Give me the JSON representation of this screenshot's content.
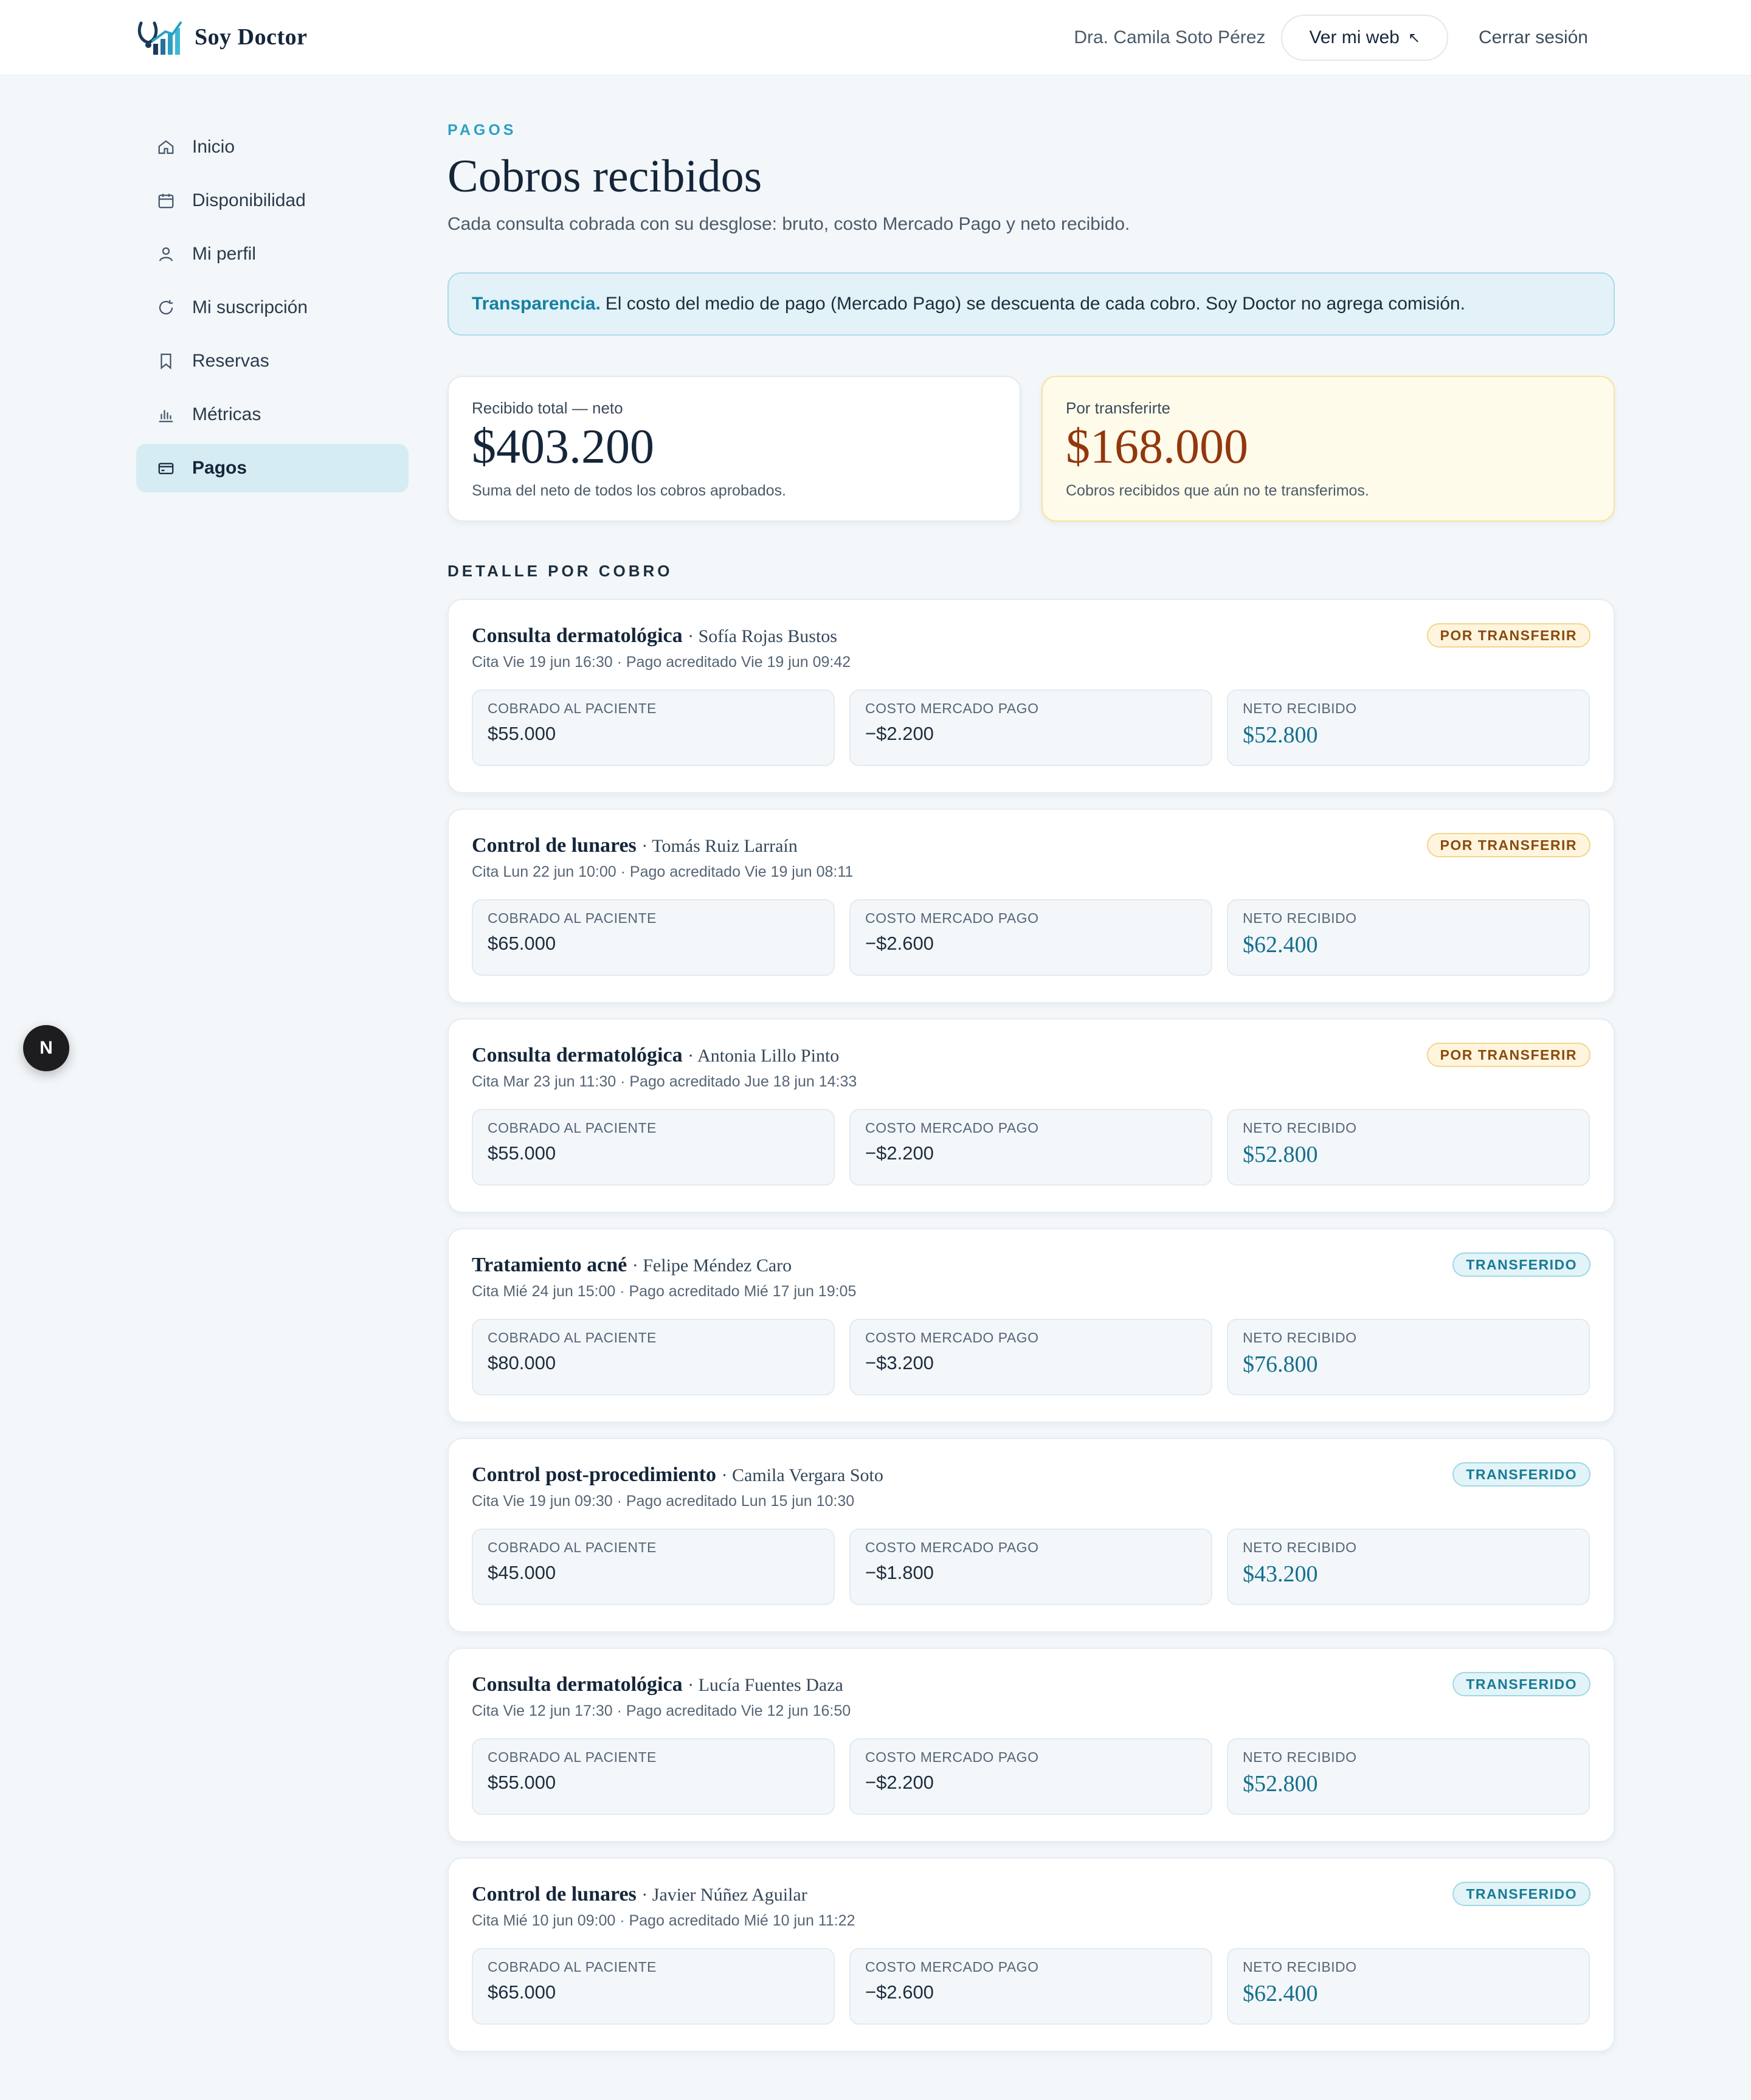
{
  "header": {
    "brand": "Soy Doctor",
    "doctor": "Dra. Camila Soto Pérez",
    "web_button": "Ver mi web",
    "logout": "Cerrar sesión"
  },
  "sidebar": {
    "items": [
      {
        "label": "Inicio",
        "icon": "home-icon"
      },
      {
        "label": "Disponibilidad",
        "icon": "calendar-icon"
      },
      {
        "label": "Mi perfil",
        "icon": "user-icon"
      },
      {
        "label": "Mi suscripción",
        "icon": "refresh-icon"
      },
      {
        "label": "Reservas",
        "icon": "bookmark-icon"
      },
      {
        "label": "Métricas",
        "icon": "bar-chart-icon"
      },
      {
        "label": "Pagos",
        "icon": "credit-card-icon",
        "active": true
      }
    ]
  },
  "fab": "N",
  "page": {
    "eyebrow": "PAGOS",
    "title": "Cobros recibidos",
    "subtitle": "Cada consulta cobrada con su desglose: bruto, costo Mercado Pago y neto recibido."
  },
  "notice": {
    "strong": "Transparencia.",
    "text": "El costo del medio de pago (Mercado Pago) se descuenta de cada cobro. Soy Doctor no agrega comisión."
  },
  "summary": {
    "total": {
      "label": "Recibido total — neto",
      "value": "$403.200",
      "note": "Suma del neto de todos los cobros aprobados."
    },
    "pending": {
      "label": "Por transferirte",
      "value": "$168.000",
      "note": "Cobros recibidos que aún no te transferimos."
    }
  },
  "section_title": "DETALLE POR COBRO",
  "labels": {
    "gross": "COBRADO AL PACIENTE",
    "fee": "COSTO MERCADO PAGO",
    "net": "NETO RECIBIDO"
  },
  "charges": [
    {
      "service": "Consulta dermatológica",
      "patient": "Sofía Rojas Bustos",
      "meta": "Cita Vie 19 jun 16:30 · Pago acreditado Vie 19 jun 09:42",
      "status": "POR TRANSFERIR",
      "status_type": "pending",
      "gross": "$55.000",
      "fee": "−$2.200",
      "net": "$52.800"
    },
    {
      "service": "Control de lunares",
      "patient": "Tomás Ruiz Larraín",
      "meta": "Cita Lun 22 jun 10:00 · Pago acreditado Vie 19 jun 08:11",
      "status": "POR TRANSFERIR",
      "status_type": "pending",
      "gross": "$65.000",
      "fee": "−$2.600",
      "net": "$62.400"
    },
    {
      "service": "Consulta dermatológica",
      "patient": "Antonia Lillo Pinto",
      "meta": "Cita Mar 23 jun 11:30 · Pago acreditado Jue 18 jun 14:33",
      "status": "POR TRANSFERIR",
      "status_type": "pending",
      "gross": "$55.000",
      "fee": "−$2.200",
      "net": "$52.800"
    },
    {
      "service": "Tratamiento acné",
      "patient": "Felipe Méndez Caro",
      "meta": "Cita Mié 24 jun 15:00 · Pago acreditado Mié 17 jun 19:05",
      "status": "TRANSFERIDO",
      "status_type": "done",
      "gross": "$80.000",
      "fee": "−$3.200",
      "net": "$76.800"
    },
    {
      "service": "Control post-procedimiento",
      "patient": "Camila Vergara Soto",
      "meta": "Cita Vie 19 jun 09:30 · Pago acreditado Lun 15 jun 10:30",
      "status": "TRANSFERIDO",
      "status_type": "done",
      "gross": "$45.000",
      "fee": "−$1.800",
      "net": "$43.200"
    },
    {
      "service": "Consulta dermatológica",
      "patient": "Lucía Fuentes Daza",
      "meta": "Cita Vie 12 jun 17:30 · Pago acreditado Vie 12 jun 16:50",
      "status": "TRANSFERIDO",
      "status_type": "done",
      "gross": "$55.000",
      "fee": "−$2.200",
      "net": "$52.800"
    },
    {
      "service": "Control de lunares",
      "patient": "Javier Núñez Aguilar",
      "meta": "Cita Mié 10 jun 09:00 · Pago acreditado Mié 10 jun 11:22",
      "status": "TRANSFERIDO",
      "status_type": "done",
      "gross": "$65.000",
      "fee": "−$2.600",
      "net": "$62.400"
    }
  ]
}
